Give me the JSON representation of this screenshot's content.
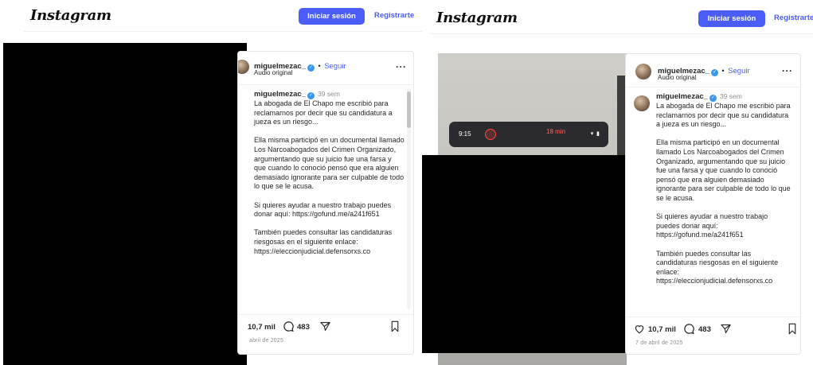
{
  "header": {
    "logo": "Instagram",
    "login_label": "Iniciar sesión",
    "register_label": "Registrarte"
  },
  "post": {
    "username": "miguelmezac_",
    "separator": "•",
    "follow_label": "Seguir",
    "audio_label": "Audio original",
    "more_label": "···",
    "time_ago": "39 sem",
    "caption": [
      "La abogada de El Chapo me escribió para reclamarnos por decir que su candidatura a jueza es un riesgo...",
      "Ella misma participó en un documental llamado Los Narcoabogados del Crimen Organizado, argumentando que su juicio fue una farsa y que cuando lo conoció pensó que era alguien demasiado ignorante para ser culpable de todo lo que se le acusa.",
      "Si quieres ayudar a nuestro trabajo puedes donar aquí: https://gofund.me/a241f651",
      "También puedes consultar las candidaturas riesgosas en el siguiente enlace: https://eleccionjudicial.defensorxs.co"
    ],
    "likes": "10,7 mil",
    "comments": "483",
    "date_left": "abril de 2025",
    "date_right": "7 de abril de 2025"
  },
  "phone_overlay": {
    "time": "9:15",
    "pill": "18 min",
    "status": "▾ ▮"
  },
  "colors": {
    "accent": "#4a5df9",
    "verified": "#3897f0",
    "muted": "#8e8e8e"
  },
  "icons": [
    "verified-badge-icon",
    "more-options-icon",
    "comment-icon",
    "share-icon",
    "bookmark-icon"
  ]
}
